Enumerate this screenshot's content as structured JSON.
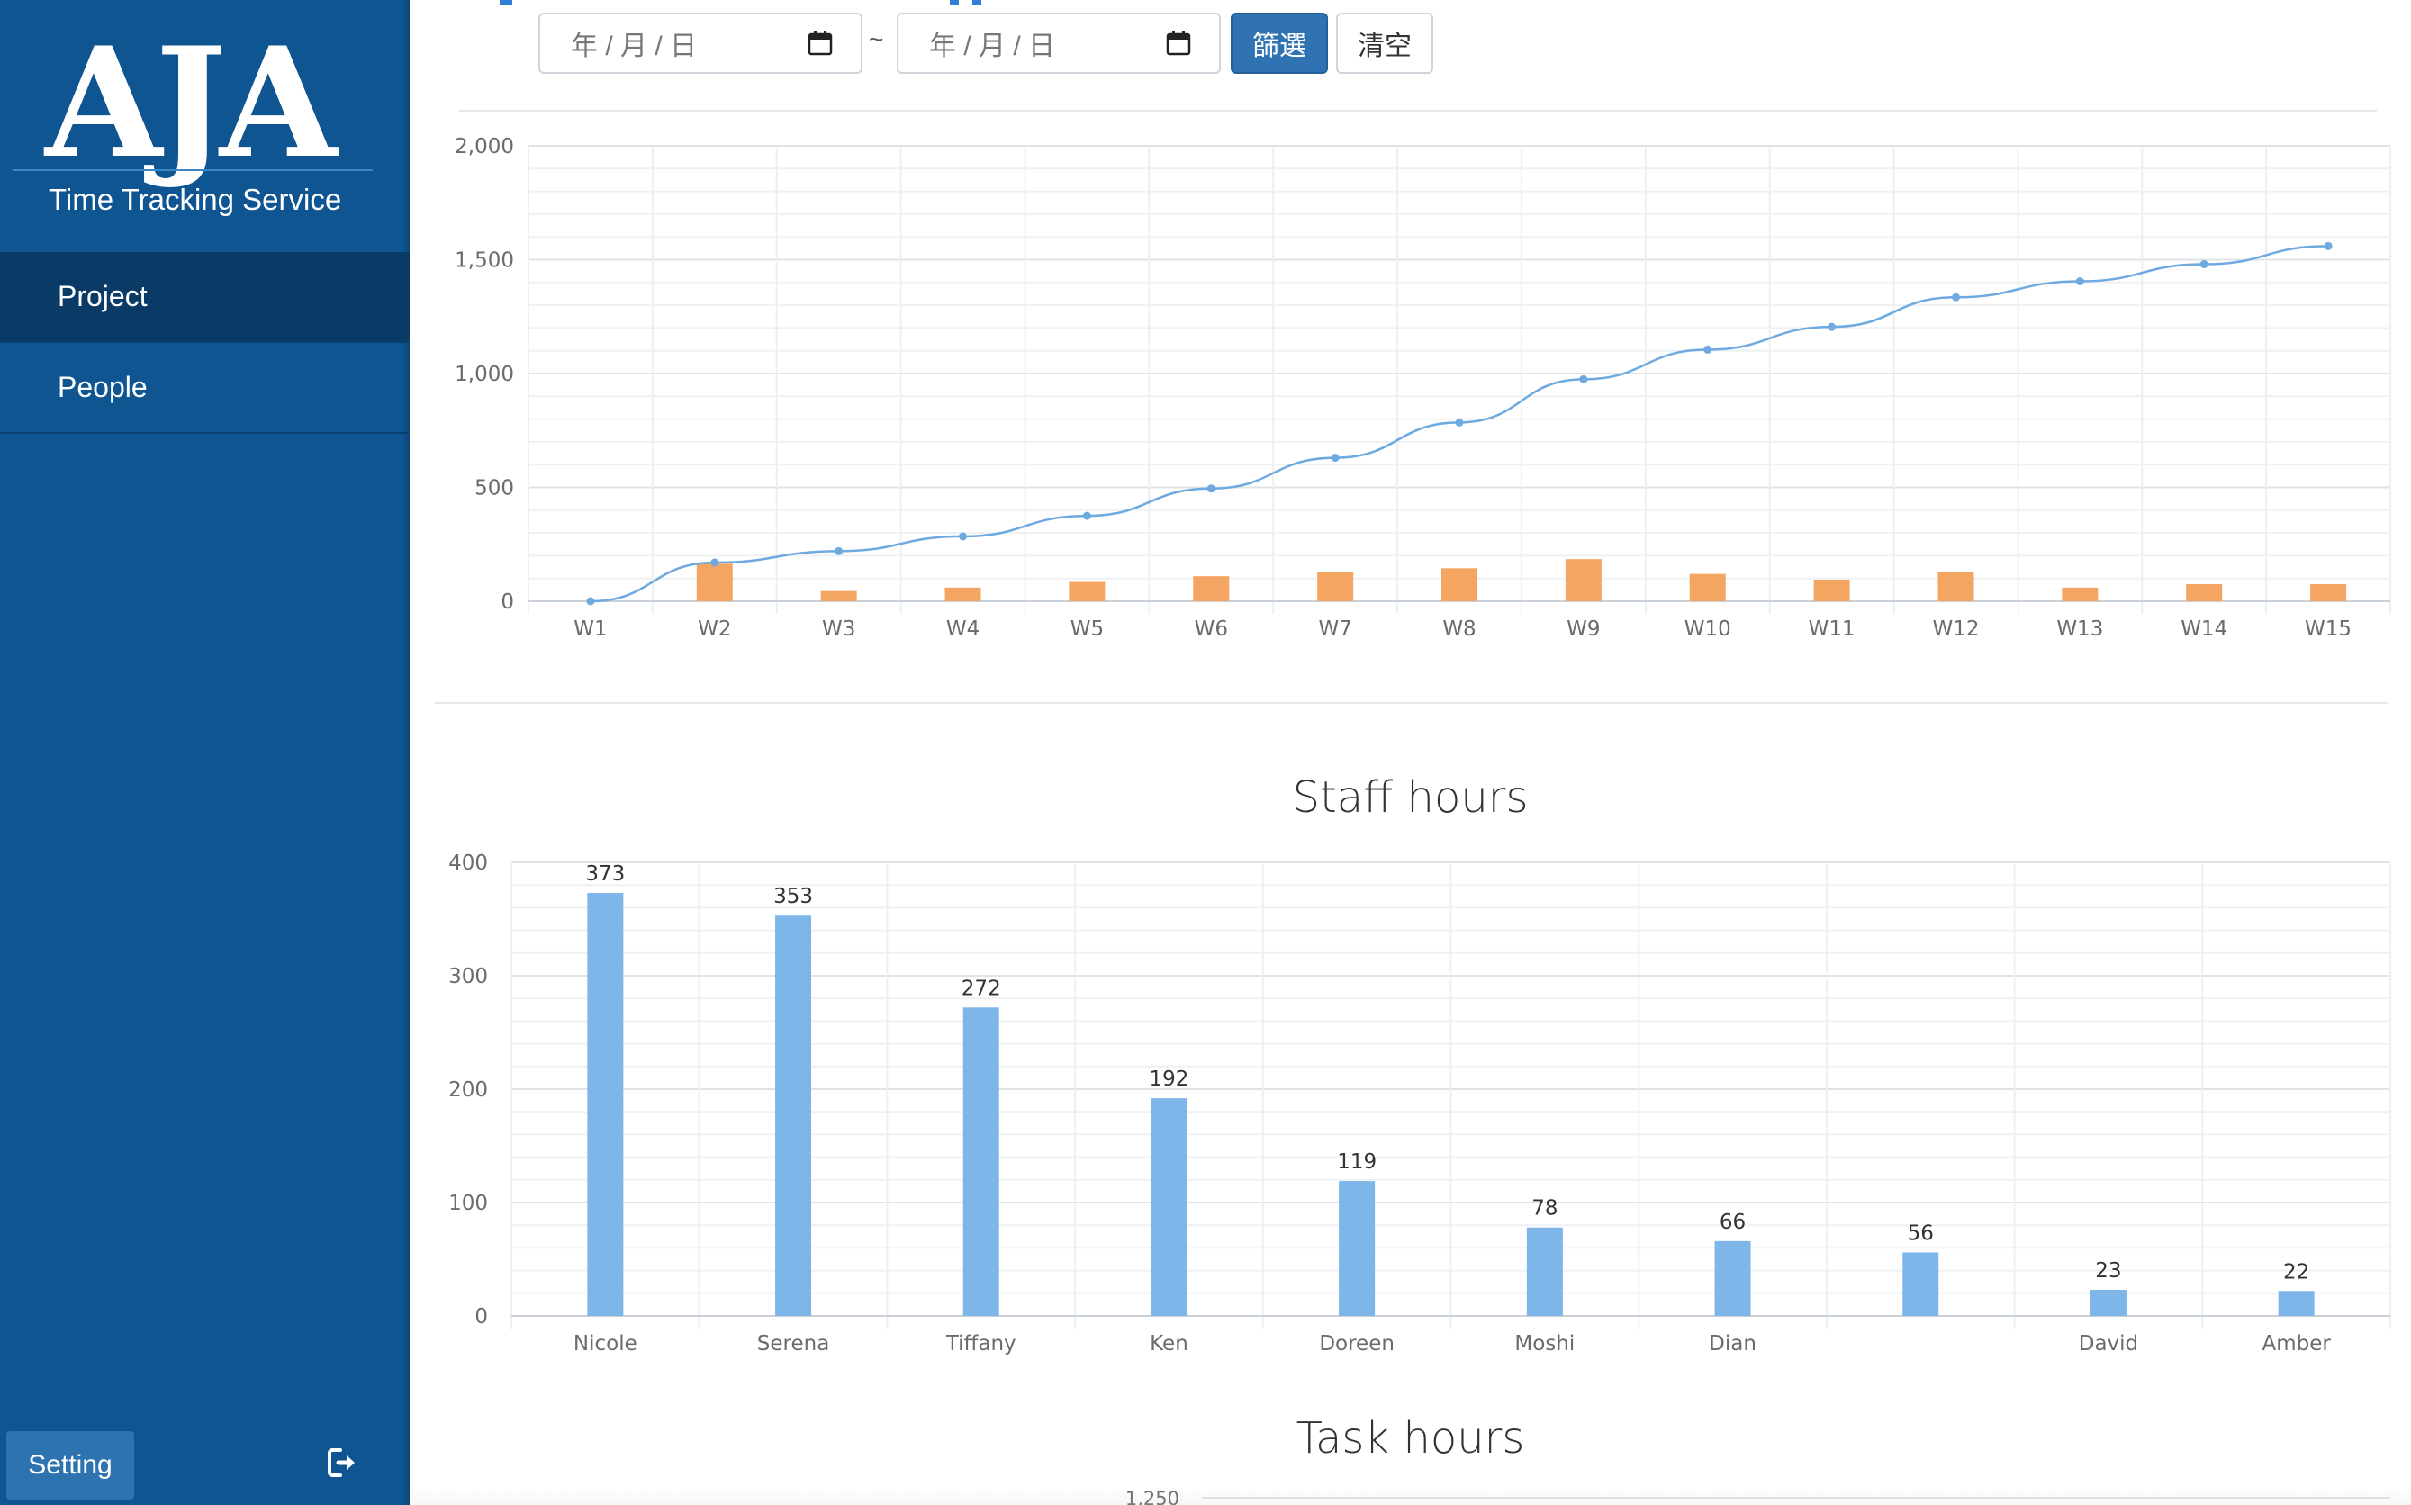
{
  "sidebar": {
    "logo": "AJA",
    "tagline": "Time Tracking Service",
    "items": [
      {
        "label": "Project",
        "active": true
      },
      {
        "label": "People",
        "active": false
      }
    ],
    "setting_label": "Setting",
    "logout_icon": "logout-icon"
  },
  "filter": {
    "start_placeholder": "年 / 月 / 日",
    "end_placeholder": "年 / 月 / 日",
    "separator": "~",
    "filter_label": "篩選",
    "clear_label": "清空"
  },
  "colors": {
    "sidebar": "#0e5592",
    "line": "#6ea9e0",
    "bar_orange": "#f4a562",
    "bar_blue": "#7eb6ea",
    "accent": "#2f73b3"
  },
  "chart_data": [
    {
      "type": "bar+line",
      "title": "",
      "categories": [
        "W1",
        "W2",
        "W3",
        "W4",
        "W5",
        "W6",
        "W7",
        "W8",
        "W9",
        "W10",
        "W11",
        "W12",
        "W13",
        "W14",
        "W15"
      ],
      "series": [
        {
          "type": "line",
          "values": [
            0,
            170,
            220,
            285,
            375,
            495,
            630,
            785,
            975,
            1105,
            1205,
            1335,
            1405,
            1480,
            1560
          ]
        },
        {
          "type": "bar",
          "values": [
            0,
            165,
            45,
            60,
            85,
            110,
            130,
            145,
            185,
            120,
            95,
            130,
            60,
            75,
            75
          ]
        }
      ],
      "yticks": [
        "0",
        "500",
        "1,000",
        "1,500",
        "2,000"
      ],
      "ylim": [
        0,
        2000
      ],
      "grid": true
    },
    {
      "type": "bar",
      "title": "Staff hours",
      "categories": [
        "Nicole",
        "Serena",
        "Tiffany",
        "Ken",
        "Doreen",
        "Moshi",
        "Dian",
        "",
        "David",
        "Amber"
      ],
      "values": [
        373,
        353,
        272,
        192,
        119,
        78,
        66,
        56,
        23,
        22
      ],
      "value_labels": [
        "373",
        "353",
        "272",
        "192",
        "119",
        "78",
        "66",
        "56",
        "23",
        "22"
      ],
      "yticks": [
        "0",
        "100",
        "200",
        "300",
        "400"
      ],
      "ylim": [
        0,
        400
      ],
      "grid": true
    },
    {
      "type": "bar",
      "title": "Task hours",
      "yticks": [
        "1,250"
      ]
    }
  ]
}
